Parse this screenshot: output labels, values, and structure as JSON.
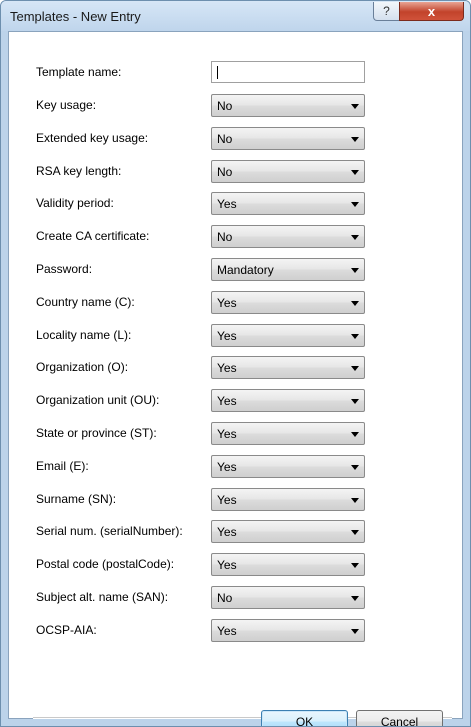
{
  "window": {
    "title": "Templates - New Entry",
    "help_glyph": "?",
    "close_glyph": "x"
  },
  "form": {
    "template_name": {
      "label": "Template name:",
      "value": ""
    },
    "fields": [
      {
        "label": "Key usage:",
        "value": "No"
      },
      {
        "label": "Extended key usage:",
        "value": "No"
      },
      {
        "label": "RSA key length:",
        "value": "No"
      },
      {
        "label": "Validity period:",
        "value": "Yes"
      },
      {
        "label": "Create CA certificate:",
        "value": "No"
      },
      {
        "label": "Password:",
        "value": "Mandatory"
      },
      {
        "label": "Country name (C):",
        "value": "Yes"
      },
      {
        "label": "Locality name (L):",
        "value": "Yes"
      },
      {
        "label": "Organization (O):",
        "value": "Yes"
      },
      {
        "label": "Organization unit (OU):",
        "value": "Yes"
      },
      {
        "label": "State or province (ST):",
        "value": "Yes"
      },
      {
        "label": "Email (E):",
        "value": "Yes"
      },
      {
        "label": "Surname (SN):",
        "value": "Yes"
      },
      {
        "label": "Serial num. (serialNumber):",
        "value": "Yes"
      },
      {
        "label": "Postal code (postalCode):",
        "value": "Yes"
      },
      {
        "label": "Subject alt. name (SAN):",
        "value": "No"
      },
      {
        "label": "OCSP-AIA:",
        "value": "Yes"
      }
    ]
  },
  "buttons": {
    "ok_label": "OK",
    "cancel_label": "Cancel"
  }
}
